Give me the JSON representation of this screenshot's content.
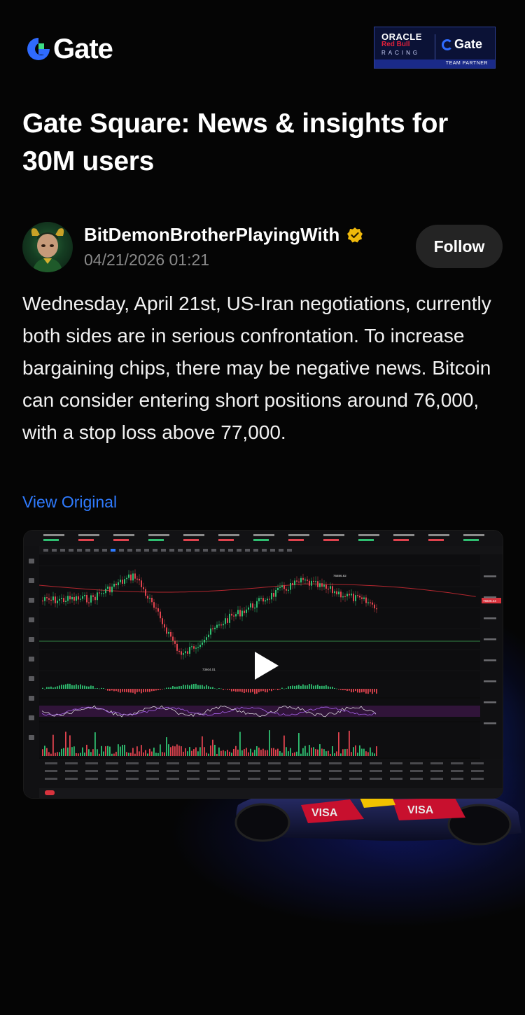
{
  "brand": {
    "name": "Gate",
    "accent": "#2F6BFF",
    "logo_accent": "#3DDC84"
  },
  "partner_badge": {
    "line1": "ORACLE",
    "line2": "Red Bull",
    "line3": "RACING",
    "brand": "Gate",
    "tagline": "TEAM PARTNER"
  },
  "headline": "Gate Square: News & insights for 30M users",
  "post": {
    "author": "BitDemonBrotherPlayingWith",
    "verified_icon": "verified-badge-icon",
    "timestamp": "04/21/2026 01:21",
    "follow_label": "Follow",
    "body": "Wednesday, April 21st, US-Iran negotiations, currently both sides are in serious confrontation. To increase bargaining chips, there may be negative news. Bitcoin can consider entering short positions around 76,000, with a stop loss above 77,000.",
    "view_original_label": "View Original"
  },
  "media": {
    "kind": "video-thumbnail",
    "play_icon": "play-icon",
    "chart_labels": {
      "high": "76886.82",
      "low": "73604.01",
      "price": "75826.44"
    }
  }
}
